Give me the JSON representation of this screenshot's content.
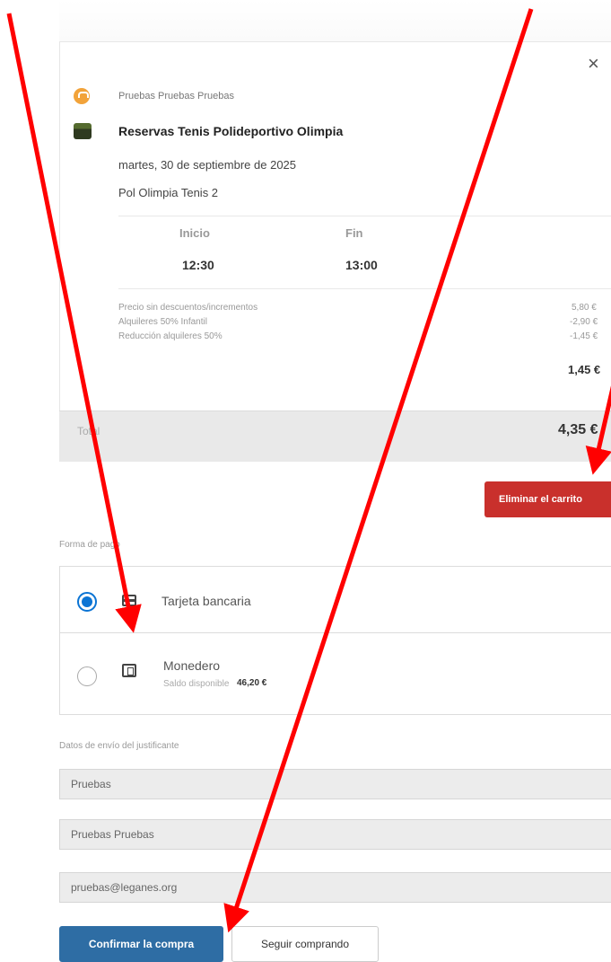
{
  "booking": {
    "close_label": "×",
    "user_name": "Pruebas Pruebas Pruebas",
    "title": "Reservas Tenis Polideportivo Olimpia",
    "date": "martes, 30 de septiembre de 2025",
    "court": "Pol Olimpia Tenis 2",
    "start_label": "Inicio",
    "end_label": "Fin",
    "start_time": "12:30",
    "end_time": "13:00",
    "price_lines": [
      {
        "label": "Precio sin descuentos/incrementos",
        "amount": "5,80 €"
      },
      {
        "label": "Alquileres 50% Infantil",
        "amount": "-2,90 €"
      },
      {
        "label": "Reducción alquileres 50%",
        "amount": "-1,45 €"
      }
    ],
    "subtotal": "1,45 €",
    "total_label": "Total",
    "total_amount": "4,35 €"
  },
  "actions": {
    "delete_cart": "Eliminar el carrito"
  },
  "payment": {
    "section_label": "Forma de pago",
    "options": [
      {
        "label": "Tarjeta bancaria",
        "selected": true
      },
      {
        "label": "Monedero",
        "balance_label": "Saldo disponible",
        "balance": "46,20 €",
        "selected": false
      }
    ]
  },
  "receipt": {
    "section_label": "Datos de envío del justificante",
    "first_name": "Pruebas",
    "last_name": "Pruebas Pruebas",
    "email": "pruebas@leganes.org"
  },
  "footer": {
    "confirm": "Confirmar la compra",
    "continue": "Seguir comprando"
  },
  "annotation_color": "#ff0000"
}
